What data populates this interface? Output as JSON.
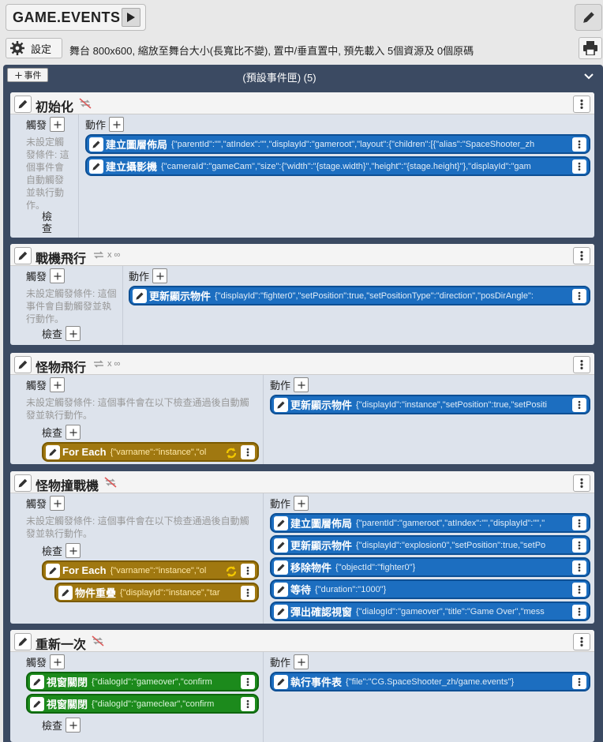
{
  "app": {
    "title": "GAME.EVENTS",
    "settings_label": "設定",
    "settings_desc": "舞台 800x600, 縮放至舞台大小(長寬比不變), 置中/垂直置中, 預先載入 5個資源及 0個原碼"
  },
  "group": {
    "add_label": "事件",
    "title": "(預設事件匣) (5)"
  },
  "labels": {
    "trigger": "觸發",
    "action": "動作",
    "check": "檢查",
    "loop": "x ∞"
  },
  "events": [
    {
      "title": "初始化",
      "no_trigger": "未設定觸發條件: 這個事件會自動觸發並執行動作。",
      "actions": [
        {
          "name": "建立圖層佈局",
          "args": "{\"parentId\":\"\",\"atIndex\":\"\",\"displayId\":\"gameroot\",\"layout\":{\"children\":[{\"alias\":\"SpaceShooter_zh"
        },
        {
          "name": "建立攝影機",
          "args": "{\"cameraId\":\"gameCam\",\"size\":{\"width\":\"{stage.width}\",\"height\":\"{stage.height}\"},\"displayId\":\"gam"
        }
      ]
    },
    {
      "title": "戰機飛行",
      "no_trigger": "未設定觸發條件: 這個事件會自動觸發並執行動作。",
      "actions": [
        {
          "name": "更新顯示物件",
          "args": "{\"displayId\":\"fighter0\",\"setPosition\":true,\"setPositionType\":\"direction\",\"posDirAngle\":"
        }
      ]
    },
    {
      "title": "怪物飛行",
      "no_trigger": "未設定觸發條件: 這個事件會在以下檢查通過後自動觸發並執行動作。",
      "checks": [
        {
          "name": "For Each",
          "args": "{\"varname\":\"instance\",\"ol"
        }
      ],
      "actions": [
        {
          "name": "更新顯示物件",
          "args": "{\"displayId\":\"instance\",\"setPosition\":true,\"setPositi"
        }
      ]
    },
    {
      "title": "怪物撞戰機",
      "no_trigger": "未設定觸發條件: 這個事件會在以下檢查通過後自動觸發並執行動作。",
      "checks": [
        {
          "name": "For Each",
          "args": "{\"varname\":\"instance\",\"ol"
        },
        {
          "name": "物件重疊",
          "args": "{\"displayId\":\"instance\",\"tar"
        }
      ],
      "actions": [
        {
          "name": "建立圖層佈局",
          "args": "{\"parentId\":\"gameroot\",\"atIndex\":\"\",\"displayId\":\"\",\""
        },
        {
          "name": "更新顯示物件",
          "args": "{\"displayId\":\"explosion0\",\"setPosition\":true,\"setPo"
        },
        {
          "name": "移除物件",
          "args": "{\"objectId\":\"fighter0\"}"
        },
        {
          "name": "等待",
          "args": "{\"duration\":\"1000\"}"
        },
        {
          "name": "彈出確認視窗",
          "args": "{\"dialogId\":\"gameover\",\"title\":\"Game Over\",\"mess"
        }
      ]
    },
    {
      "title": "重新一次",
      "triggers": [
        {
          "name": "視窗關閉",
          "args": "{\"dialogId\":\"gameover\",\"confirm"
        },
        {
          "name": "視窗關閉",
          "args": "{\"dialogId\":\"gameclear\",\"confirm"
        }
      ],
      "actions": [
        {
          "name": "執行事件表",
          "args": "{\"file\":\"CG.SpaceShooter_zh/game.events\"}"
        }
      ]
    }
  ],
  "colors": {
    "panel": "#3b4a62",
    "card": "#dde3ec",
    "action": "#1c6ec0",
    "check": "#a07810",
    "trigger": "#1c8a1c",
    "loop": "#f3c800"
  },
  "icons": [
    "play-icon",
    "pencil-icon",
    "gear-icon",
    "printer-icon",
    "plus-icon",
    "chevron-down-icon",
    "kebab-menu-icon",
    "repeat-icon",
    "loop-icon"
  ]
}
